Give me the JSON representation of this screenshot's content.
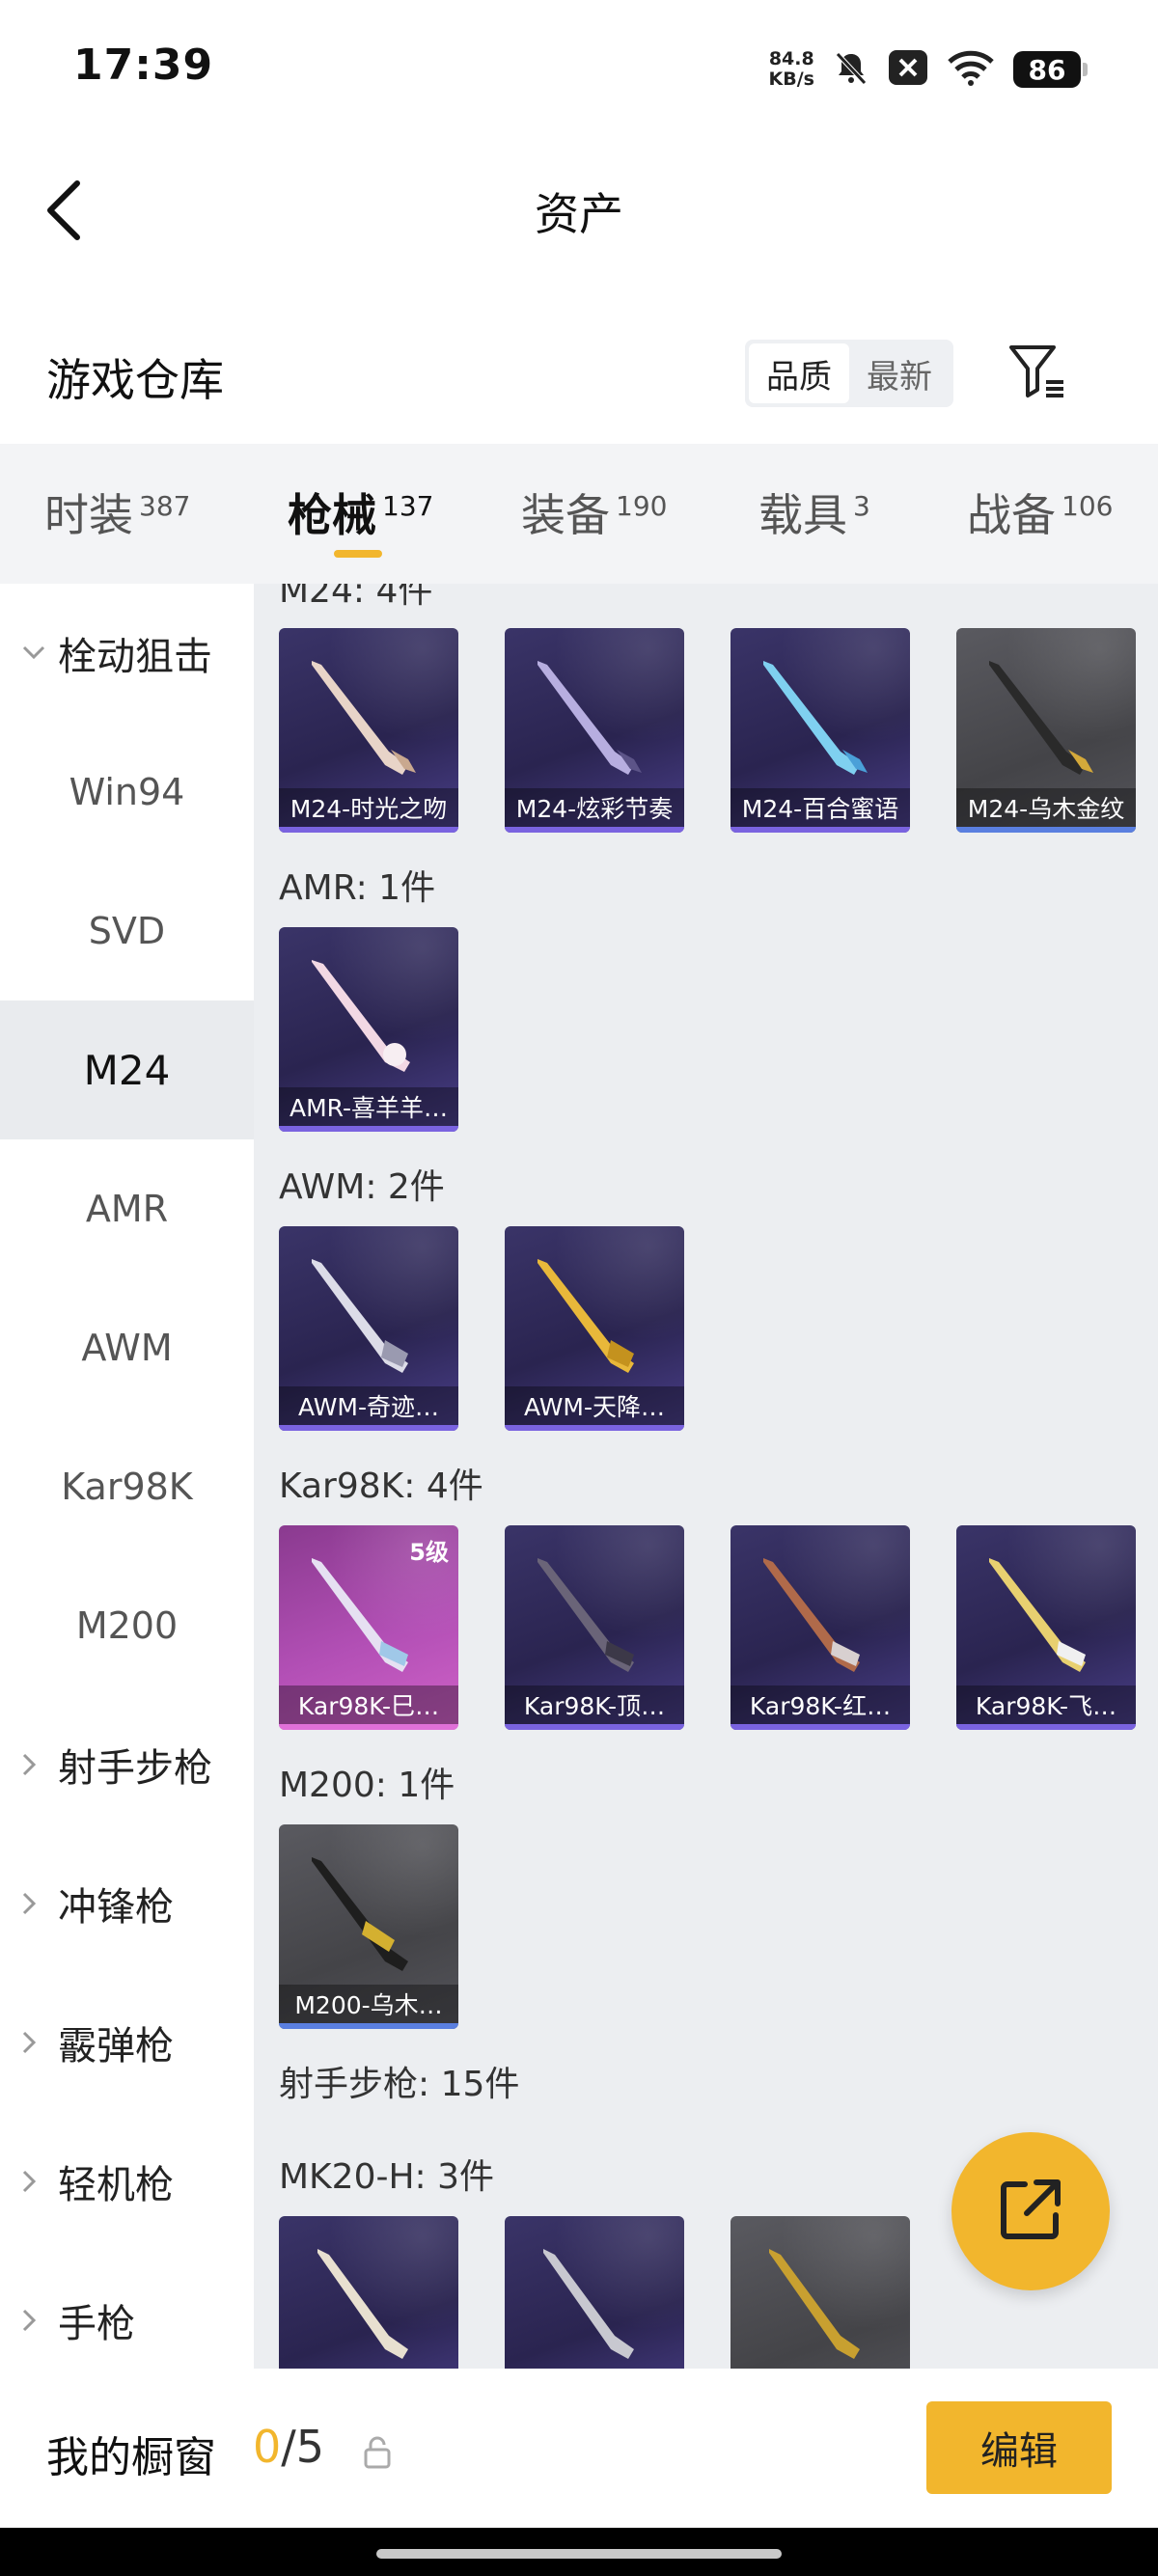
{
  "status_bar": {
    "time": "17:39",
    "net_speed_value": "84.8",
    "net_speed_unit": "KB/s",
    "battery": "86",
    "icons": [
      "mute-bell-icon",
      "notification-x-icon",
      "wifi-icon",
      "battery-icon"
    ]
  },
  "header": {
    "title": "资产",
    "back_icon": "chevron-left-icon"
  },
  "warehouse": {
    "title": "游戏仓库",
    "sort_options": [
      "品质",
      "最新"
    ],
    "sort_selected": "品质",
    "filter_icon": "filter-icon"
  },
  "tabs": [
    {
      "label": "时装",
      "count": "387",
      "active": false
    },
    {
      "label": "枪械",
      "count": "137",
      "active": true
    },
    {
      "label": "装备",
      "count": "190",
      "active": false
    },
    {
      "label": "载具",
      "count": "3",
      "active": false
    },
    {
      "label": "战备",
      "count": "106",
      "active": false
    }
  ],
  "sidebar": {
    "items": [
      {
        "label": "栓动狙击",
        "type": "parent",
        "expanded": true
      },
      {
        "label": "Win94",
        "type": "child"
      },
      {
        "label": "SVD",
        "type": "child"
      },
      {
        "label": "M24",
        "type": "child",
        "active": true
      },
      {
        "label": "AMR",
        "type": "child"
      },
      {
        "label": "AWM",
        "type": "child"
      },
      {
        "label": "Kar98K",
        "type": "child"
      },
      {
        "label": "M200",
        "type": "child"
      },
      {
        "label": "射手步枪",
        "type": "parent",
        "expanded": false
      },
      {
        "label": "冲锋枪",
        "type": "parent",
        "expanded": false
      },
      {
        "label": "霰弹枪",
        "type": "parent",
        "expanded": false
      },
      {
        "label": "轻机枪",
        "type": "parent",
        "expanded": false
      },
      {
        "label": "手枪",
        "type": "parent",
        "expanded": false
      }
    ]
  },
  "content": {
    "groups": [
      {
        "title": "M24: 4件",
        "items": [
          {
            "name": "M24-时光之吻",
            "style": "purple"
          },
          {
            "name": "M24-炫彩节奏",
            "style": "purple"
          },
          {
            "name": "M24-百合蜜语",
            "style": "purple"
          },
          {
            "name": "M24-乌木金纹",
            "style": "gray"
          }
        ]
      },
      {
        "title": "AMR: 1件",
        "items": [
          {
            "name": "AMR-喜羊羊…",
            "style": "purple"
          }
        ]
      },
      {
        "title": "AWM: 2件",
        "items": [
          {
            "name": "AWM-奇迹…",
            "style": "purple"
          },
          {
            "name": "AWM-天降…",
            "style": "purple"
          }
        ]
      },
      {
        "title": "Kar98K: 4件",
        "items": [
          {
            "name": "Kar98K-巳…",
            "style": "pink",
            "level": "5级"
          },
          {
            "name": "Kar98K-顶…",
            "style": "purple"
          },
          {
            "name": "Kar98K-红…",
            "style": "purple"
          },
          {
            "name": "Kar98K-飞…",
            "style": "purple"
          }
        ]
      },
      {
        "title": "M200: 1件",
        "items": [
          {
            "name": "M200-乌木…",
            "style": "gray"
          }
        ]
      },
      {
        "title": "射手步枪: 15件",
        "items": []
      },
      {
        "title": "MK20-H: 3件",
        "items": [
          {
            "name": "",
            "style": "purple"
          },
          {
            "name": "",
            "style": "purple"
          },
          {
            "name": "",
            "style": "gray"
          }
        ]
      }
    ]
  },
  "fab": {
    "icon": "share-external-icon"
  },
  "showcase": {
    "title": "我的橱窗",
    "current": "0",
    "separator": "/",
    "max": "5",
    "lock_icon": "lock-icon",
    "edit_label": "编辑"
  },
  "colors": {
    "accent": "#f2b62d",
    "purple_card": "#2a2450",
    "gray_card": "#444448",
    "pink_card": "#b24fb5"
  }
}
